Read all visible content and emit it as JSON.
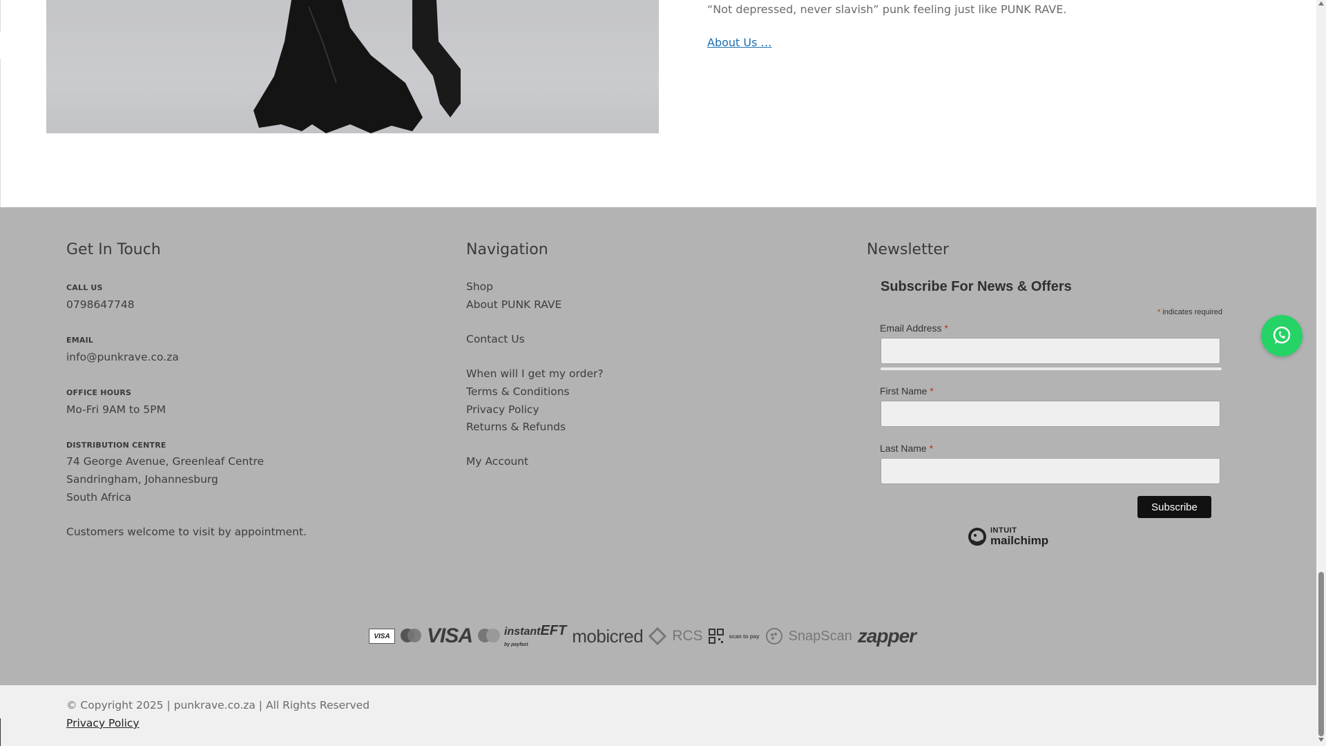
{
  "about": {
    "quote": "“Not depressed, never slavish” punk feeling just like PUNK RAVE.",
    "link": "About Us …"
  },
  "footer": {
    "contact": {
      "title": "Get In Touch",
      "call_label": "CALL US",
      "phone": "0798647748",
      "email_label": "EMAIL",
      "email": "info@punkrave.co.za",
      "hours_label": "OFFICE HOURS",
      "hours": "Mo-Fri 9AM to 5PM",
      "dist_label": "DISTRIBUTION CENTRE",
      "address_line1": "74 George Avenue, Greenleaf Centre",
      "address_line2": "Sandringham, Johannesburg",
      "address_line3": "South Africa",
      "visit_note": "Customers welcome to visit by appointment."
    },
    "navigation": {
      "title": "Navigation",
      "items": [
        "Shop",
        "About PUNK RAVE",
        "Contact Us",
        "When will I get my order?",
        "Terms & Conditions",
        "Privacy Policy",
        "Returns & Refunds",
        "My Account"
      ]
    },
    "newsletter": {
      "title": "Newsletter",
      "heading": "Subscribe For News & Offers",
      "required_star": "*",
      "required_note": "indicates required",
      "email_label": "Email Address",
      "first_name_label": "First Name",
      "last_name_label": "Last Name",
      "field_required_star": "*",
      "email_value": "",
      "first_name_value": "",
      "last_name_value": "",
      "subscribe_label": "Subscribe",
      "mailchimp_intuit": "INTUIT",
      "mailchimp_name": "mailchimp"
    },
    "payments": {
      "visa_card": "VISA",
      "visa": "VISA",
      "instant": "instant",
      "eft": "EFT",
      "payfast": "by payfast",
      "mobicred": "mobicred",
      "rcs": "RCS",
      "scantopay": "scan to pay",
      "snapscan": "SnapScan",
      "zapper": "zapper"
    },
    "copyright": "© Copyright 2025 | punkrave.co.za | All Rights Reserved",
    "privacy": "Privacy Policy"
  },
  "colors": {
    "footer_bg": "#b3b3b3",
    "whatsapp": "#25d366",
    "link": "#1a6fb0",
    "required": "#c02b0a"
  }
}
